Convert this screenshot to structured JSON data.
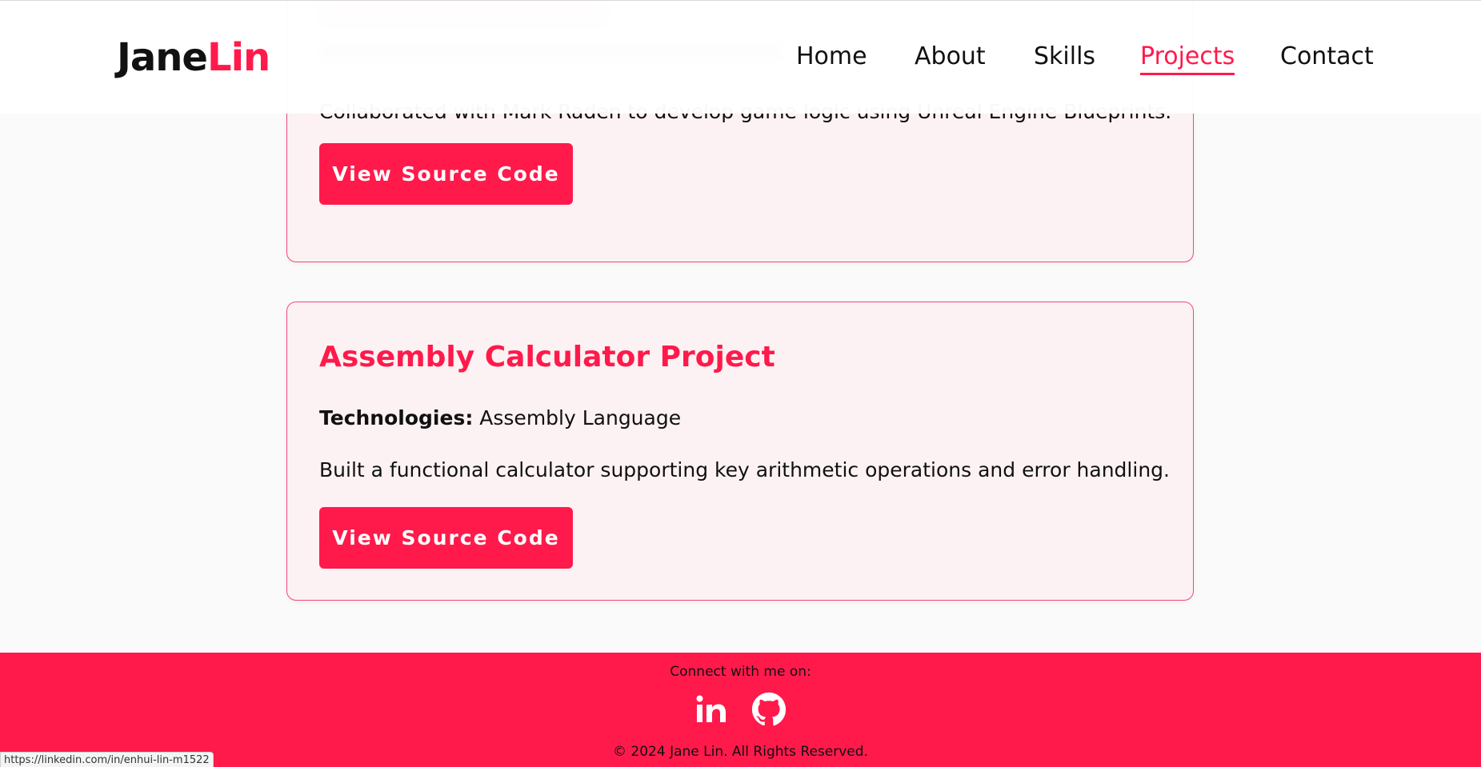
{
  "header": {
    "logo_first": "Jane",
    "logo_second": "Lin",
    "nav": [
      {
        "label": "Home"
      },
      {
        "label": "About"
      },
      {
        "label": "Skills"
      },
      {
        "label": "Projects",
        "active": true
      },
      {
        "label": "Contact"
      }
    ]
  },
  "projects": [
    {
      "title": "",
      "technologies_label": "",
      "technologies": "",
      "description": "Collaborated with Mark Raden to develop game logic using Unreal Engine Blueprints.",
      "button_label": "View Source Code"
    },
    {
      "title": "Assembly Calculator Project",
      "technologies_label": "Technologies:",
      "technologies": "Assembly Language",
      "description": "Built a functional calculator supporting key arithmetic operations and error handling.",
      "button_label": "View Source Code"
    }
  ],
  "footer": {
    "connect_text": "Connect with me on:",
    "social": [
      {
        "icon": "linkedin-icon"
      },
      {
        "icon": "github-icon"
      }
    ],
    "copyright": "© 2024 Jane Lin. All Rights Reserved."
  },
  "status_bar": {
    "url": "https://linkedin.com/in/enhui-lin-m1522"
  },
  "colors": {
    "accent": "#ff1a4b",
    "card_bg": "#fdf2f3",
    "page_bg": "#fafafa"
  }
}
